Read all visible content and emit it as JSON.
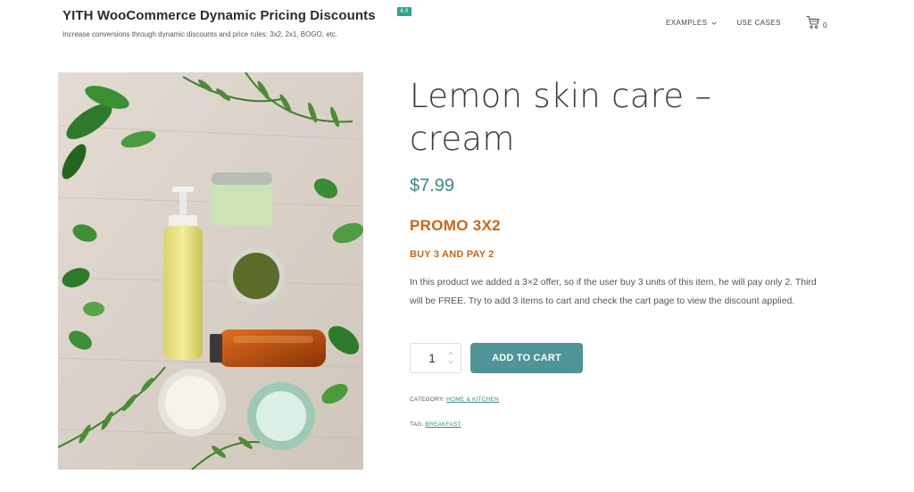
{
  "header": {
    "site_title": "YITH WooCommerce Dynamic Pricing Discounts",
    "version_badge": "4.0",
    "tagline": "Increase conversions through dynamic discounts and price rules: 3x2, 2x1, BOGO, etc.",
    "nav": [
      {
        "label": "EXAMPLES",
        "has_dropdown": true
      },
      {
        "label": "USE CASES",
        "has_dropdown": false
      }
    ],
    "cart_count": "0",
    "cart_icon": "cart-icon"
  },
  "product": {
    "image_alt": "Lemon skin care cream bottles and jars with green leaves",
    "title": "Lemon skin care – cream",
    "price": "$7.99",
    "promo_heading": "PROMO 3X2",
    "promo_subheading": "BUY 3 AND PAY 2",
    "description": "In this product we added a 3×2 offer, so if the user buy 3 units of this item, he will pay only 2. Third will be FREE. Try to add 3 items to cart and check the cart page to view the discount applied.",
    "quantity": "1",
    "add_to_cart_label": "ADD TO CART",
    "category_label": "CATEGORY:",
    "category_value": "HOME & KITCHEN",
    "tag_label": "TAG:",
    "tag_value": "BREAKFAST"
  },
  "colors": {
    "accent": "#4f9497",
    "price": "#3a8a84",
    "promo": "#c7671a",
    "badge": "#2ea38a"
  }
}
